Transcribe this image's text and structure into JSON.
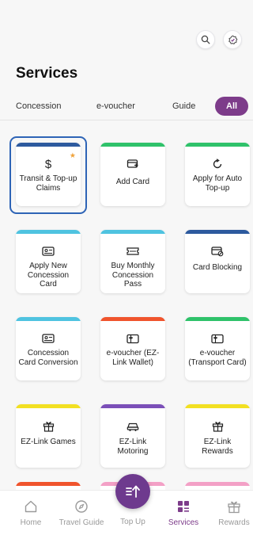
{
  "header": {
    "title": "Services",
    "actions": [
      {
        "icon": "search-icon"
      },
      {
        "icon": "settings-badge-icon"
      }
    ]
  },
  "tabs": [
    {
      "label": "Concession",
      "active": false
    },
    {
      "label": "e-voucher",
      "active": false
    },
    {
      "label": "Guide",
      "active": false
    },
    {
      "label": "All",
      "active": true
    }
  ],
  "services": [
    {
      "label": "Transit & Top-up Claims",
      "icon": "dollar-icon",
      "accent": "#2d5a9e",
      "selected": true,
      "starred": true
    },
    {
      "label": "Add Card",
      "icon": "add-card-icon",
      "accent": "#2fc26a"
    },
    {
      "label": "Apply for Auto Top-up",
      "icon": "auto-refresh-icon",
      "accent": "#2fc26a"
    },
    {
      "label": "Apply New Concession Card",
      "icon": "concession-card-icon",
      "accent": "#4fc3e0"
    },
    {
      "label": "Buy Monthly Concession Pass",
      "icon": "ticket-icon",
      "accent": "#4fc3e0"
    },
    {
      "label": "Card Blocking",
      "icon": "card-block-icon",
      "accent": "#2d5a9e"
    },
    {
      "label": "Concession Card Conversion",
      "icon": "concession-card-icon",
      "accent": "#4fc3e0"
    },
    {
      "label": "e-voucher (EZ-Link Wallet)",
      "icon": "voucher-icon",
      "accent": "#f0542d"
    },
    {
      "label": "e-voucher (Transport Card)",
      "icon": "voucher-icon",
      "accent": "#2fc26a"
    },
    {
      "label": "EZ-Link Games",
      "icon": "gift-icon",
      "accent": "#f2e022"
    },
    {
      "label": "EZ-Link Motoring",
      "icon": "car-icon",
      "accent": "#7b4fb8"
    },
    {
      "label": "EZ-Link Rewards",
      "icon": "gift-icon",
      "accent": "#f2e022"
    }
  ],
  "partial_row_accents": [
    "#f0542d",
    "#f3a0c6",
    "#f3a0c6"
  ],
  "bottom_nav": [
    {
      "label": "Home",
      "icon": "home-icon",
      "active": false
    },
    {
      "label": "Travel Guide",
      "icon": "compass-icon",
      "active": false
    },
    {
      "label": "Top Up",
      "icon": "top-up-icon",
      "active": false
    },
    {
      "label": "Services",
      "icon": "grid-icon",
      "active": true
    },
    {
      "label": "Rewards",
      "icon": "gift-icon",
      "active": false
    }
  ],
  "colors": {
    "brand": "#7d3c8a",
    "fab": "#6e3a8e",
    "selection": "#2e64b6"
  }
}
